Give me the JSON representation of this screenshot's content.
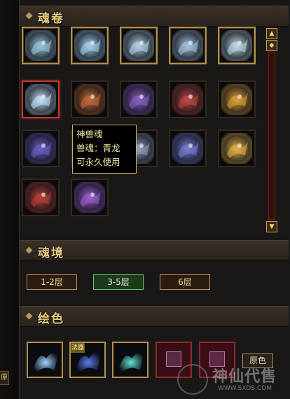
{
  "sections": {
    "soul_scroll": {
      "title": "魂卷"
    },
    "soul_realm": {
      "title": "魂境"
    },
    "paint_color": {
      "title": "绘色"
    }
  },
  "soul_slots": [
    {
      "icon": "white-bear-soul-icon",
      "state": "gold",
      "color": "#9fc9df"
    },
    {
      "icon": "white-horse-soul-icon",
      "state": "gold",
      "color": "#a8d3ef"
    },
    {
      "icon": "white-butterfly-soul-icon",
      "state": "gold",
      "color": "#b6d6ec"
    },
    {
      "icon": "white-wolf-soul-icon",
      "state": "gold",
      "color": "#a7c7e0"
    },
    {
      "icon": "white-deer-soul-icon",
      "state": "gold",
      "color": "#c3dce9"
    },
    {
      "icon": "azure-dragon-soul-icon",
      "state": "red",
      "color": "#c7e6ff"
    },
    {
      "icon": "fire-fox-soul-icon",
      "state": "dark",
      "color": "#c86d3a"
    },
    {
      "icon": "violet-butterfly-soul-icon",
      "state": "dark",
      "color": "#8e63c6"
    },
    {
      "icon": "crimson-phoenix-soul-icon",
      "state": "dark",
      "color": "#c04a44"
    },
    {
      "icon": "golden-phoenix-soul-icon",
      "state": "dark",
      "color": "#e0a23a"
    },
    {
      "icon": "violet-deer-soul-icon",
      "state": "dark",
      "color": "#6d63c9"
    },
    {
      "icon": "hidden-soul-icon",
      "state": "dark",
      "color": "#384050"
    },
    {
      "icon": "silver-fox-soul-icon",
      "state": "dark",
      "color": "#8fa2c0"
    },
    {
      "icon": "violet-fox-soul-icon",
      "state": "dark",
      "color": "#7a80d6"
    },
    {
      "icon": "golden-fox-soul-icon",
      "state": "dark",
      "color": "#e6b548"
    },
    {
      "icon": "red-wolf-soul-icon",
      "state": "dark",
      "color": "#b8443a"
    },
    {
      "icon": "purple-fox-soul-icon",
      "state": "dark",
      "color": "#a05fd0"
    }
  ],
  "tooltip": {
    "line1": "神兽魂",
    "line2": "兽魂：青龙",
    "line3": "可永久使用"
  },
  "tiers": [
    {
      "label": "1-2层"
    },
    {
      "label": "3-5层",
      "active": true
    },
    {
      "label": "6层"
    }
  ],
  "color_swatches": [
    {
      "icon": "ice-butterfly-icon",
      "color": "#9fd3ff"
    },
    {
      "icon": "sapphire-wing-icon",
      "color": "#5a7df0",
      "badge": "法器"
    },
    {
      "icon": "teal-butterfly-icon",
      "color": "#5fe3d7"
    },
    {
      "icon": "locked-swatch-icon",
      "locked": true
    },
    {
      "icon": "locked-swatch-icon",
      "locked": true
    }
  ],
  "original_color_button": {
    "label": "原色"
  },
  "left_tab": {
    "label": "原"
  },
  "watermark": {
    "title": "神仙代售",
    "url": "WWW.SXDS.COM"
  }
}
